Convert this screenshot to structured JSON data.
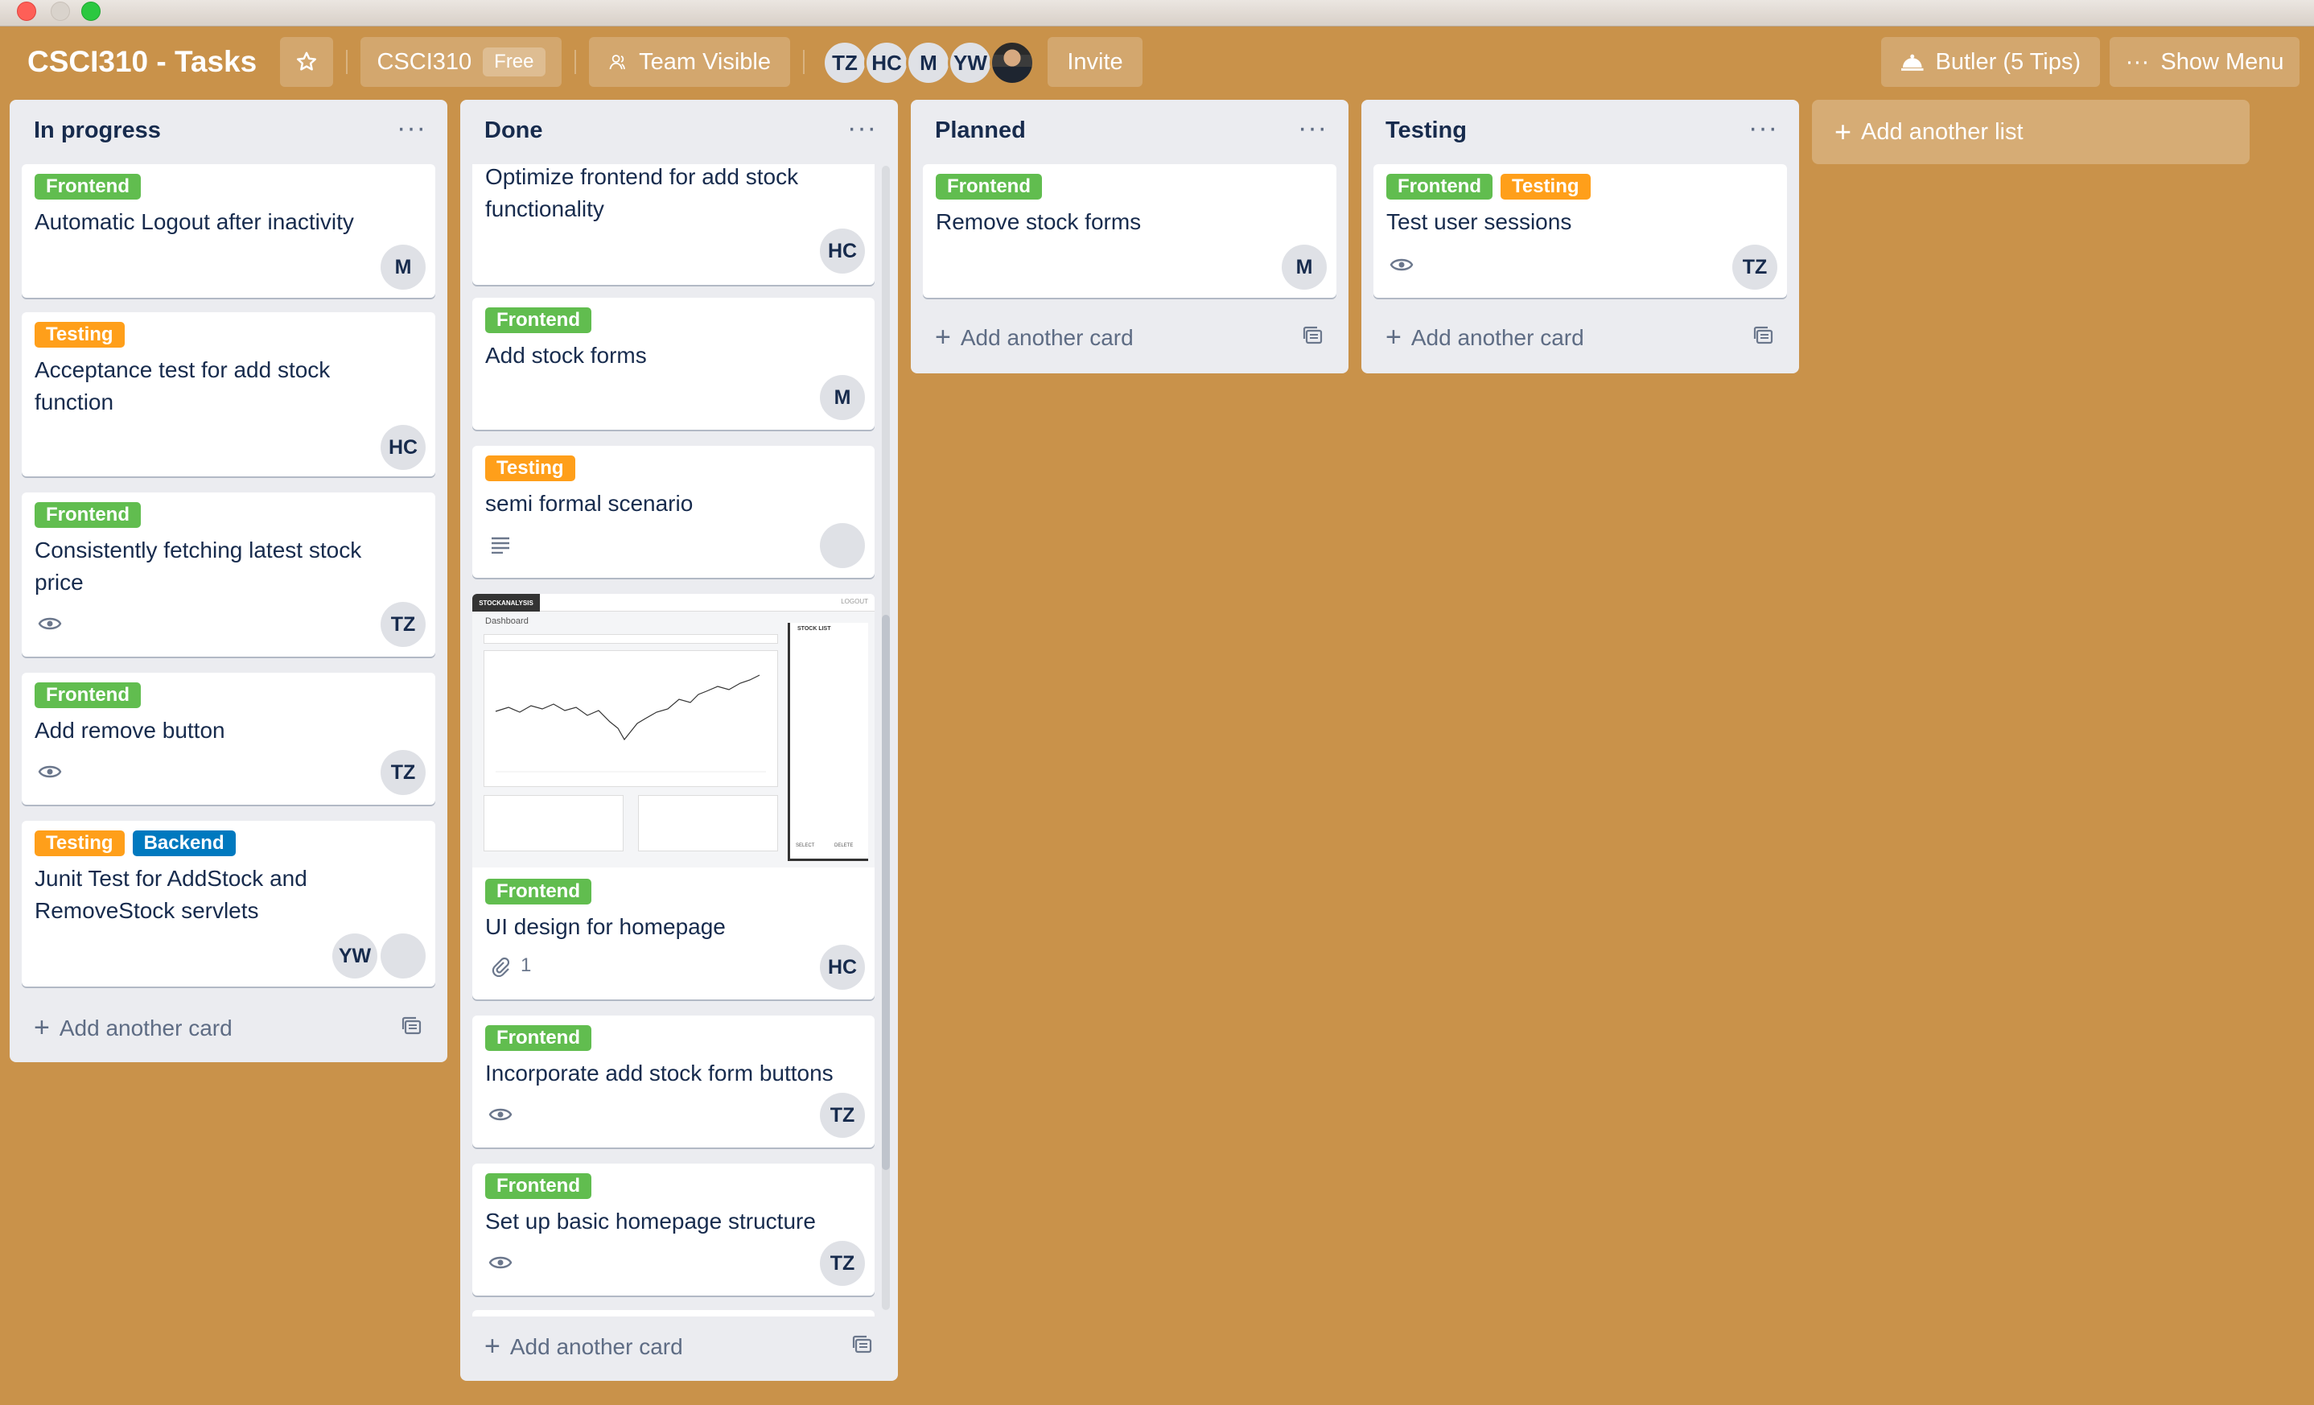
{
  "window": {
    "controls": [
      "close",
      "minimize",
      "maximize"
    ]
  },
  "header": {
    "board_title": "CSCI310 - Tasks",
    "workspace": "CSCI310",
    "workspace_badge": "Free",
    "visibility": "Team Visible",
    "members": [
      "TZ",
      "HC",
      "M",
      "YW"
    ],
    "invite": "Invite",
    "butler": "Butler (5 Tips)",
    "show_menu": "Show Menu"
  },
  "lists": [
    {
      "title": "In progress",
      "add_card": "Add another card",
      "cards": [
        {
          "labels": [
            "Frontend"
          ],
          "title": "Automatic Logout after inactivity",
          "members": [
            "M"
          ]
        },
        {
          "labels": [
            "Testing"
          ],
          "title": "Acceptance test for add stock function",
          "members": [
            "HC"
          ]
        },
        {
          "labels": [
            "Frontend"
          ],
          "title": "Consistently fetching latest stock price",
          "members": [
            "TZ"
          ],
          "badges": [
            "watching"
          ]
        },
        {
          "labels": [
            "Frontend"
          ],
          "title": "Add remove button",
          "members": [
            "TZ"
          ],
          "badges": [
            "watching"
          ]
        },
        {
          "labels": [
            "Testing",
            "Backend"
          ],
          "title": "Junit Test for AddStock and RemoveStock servlets",
          "members": [
            "YW",
            "photo"
          ]
        }
      ]
    },
    {
      "title": "Done",
      "add_card": "Add another card",
      "cards": [
        {
          "labels": [],
          "title": "Optimize frontend for add stock functionality",
          "members": [
            "HC"
          ]
        },
        {
          "labels": [
            "Frontend"
          ],
          "title": "Add stock forms",
          "members": [
            "M"
          ]
        },
        {
          "labels": [
            "Testing"
          ],
          "title": "semi formal scenario",
          "members": [
            "photo"
          ],
          "badges": [
            "description"
          ]
        },
        {
          "labels": [
            "Frontend"
          ],
          "title": "UI design for homepage",
          "members": [
            "HC"
          ],
          "badges": [
            "attachment"
          ],
          "attachments": "1",
          "cover": {
            "brand": "STOCKANALYSIS",
            "logout": "LOGOUT",
            "heading": "Dashboard",
            "panel_title": "STOCK LIST",
            "select": "SELECT",
            "delete": "DELETE"
          }
        },
        {
          "labels": [
            "Frontend"
          ],
          "title": "Incorporate add stock form buttons",
          "members": [
            "TZ"
          ],
          "badges": [
            "watching"
          ]
        },
        {
          "labels": [
            "Frontend"
          ],
          "title": "Set up basic homepage structure",
          "members": [
            "TZ"
          ],
          "badges": [
            "watching"
          ]
        }
      ]
    },
    {
      "title": "Planned",
      "add_card": "Add another card",
      "cards": [
        {
          "labels": [
            "Frontend"
          ],
          "title": "Remove stock forms",
          "members": [
            "M"
          ]
        }
      ]
    },
    {
      "title": "Testing",
      "add_card": "Add another card",
      "cards": [
        {
          "labels": [
            "Frontend",
            "Testing"
          ],
          "title": "Test user sessions",
          "members": [
            "TZ"
          ],
          "badges": [
            "watching"
          ]
        }
      ]
    }
  ],
  "add_list": "Add another list",
  "colors": {
    "board_bg": "#C9924A",
    "label_frontend": "#61bd4f",
    "label_testing": "#ff9f1a",
    "label_backend": "#0079bf",
    "list_bg": "#ebecf0"
  }
}
